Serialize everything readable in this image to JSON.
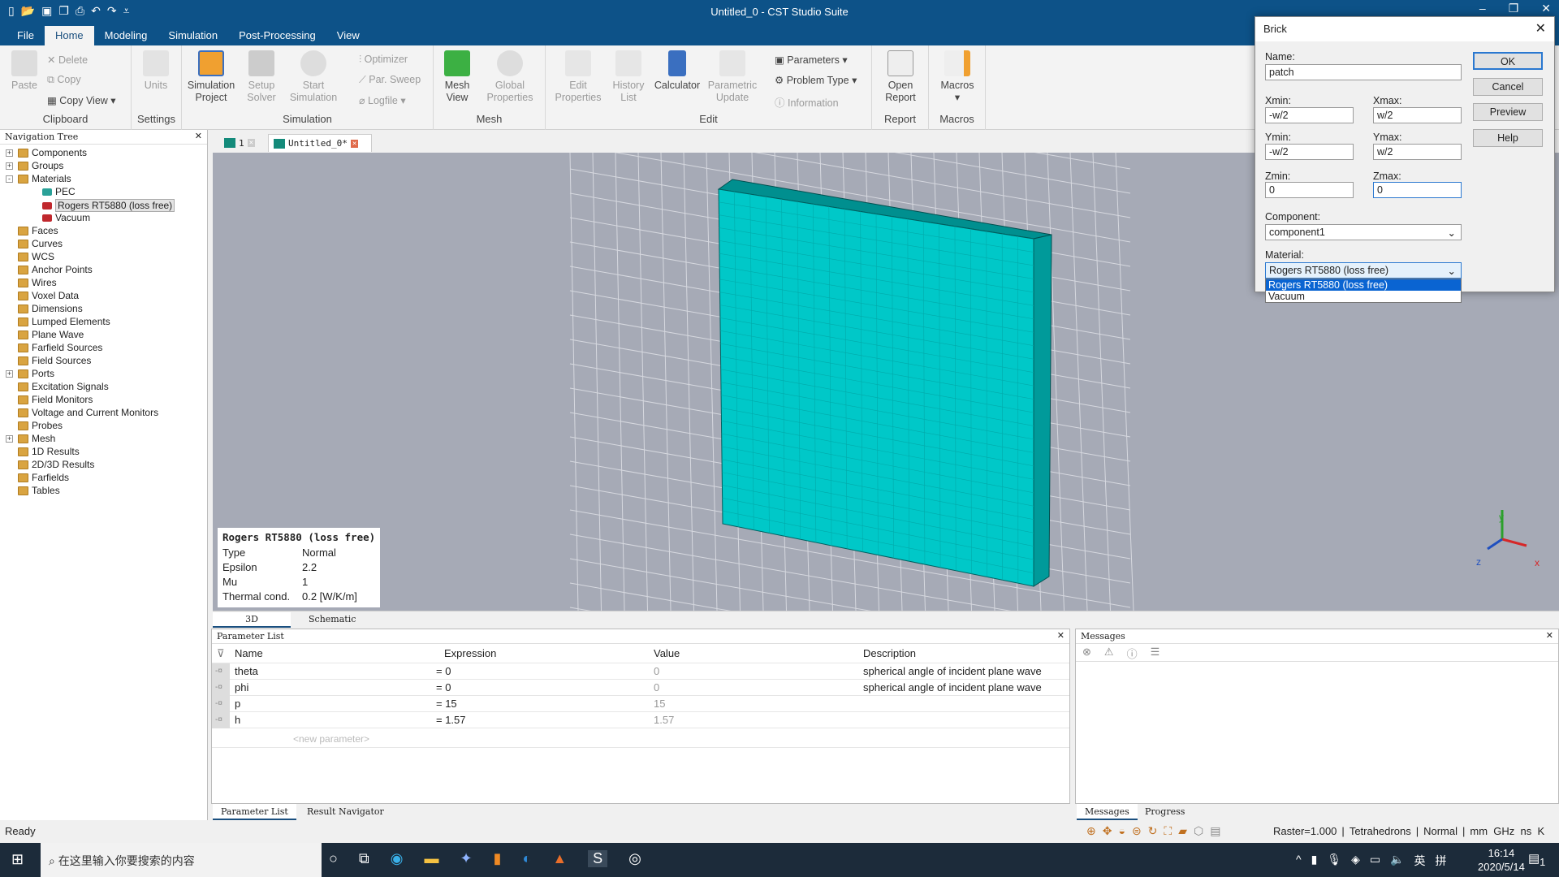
{
  "window": {
    "title": "Untitled_0 - CST Studio Suite",
    "qat_icons": [
      "new-icon",
      "open-icon",
      "save-icon",
      "save-all-icon",
      "print-icon",
      "undo-icon",
      "redo-icon",
      "customize-icon"
    ]
  },
  "menu": {
    "tabs": [
      "File",
      "Home",
      "Modeling",
      "Simulation",
      "Post-Processing",
      "View"
    ],
    "active": "Home"
  },
  "ribbon": {
    "clipboard": {
      "label": "Clipboard",
      "paste": "Paste",
      "delete": "Delete",
      "copy": "Copy",
      "copy_view": "Copy View"
    },
    "settings": {
      "label": "Settings",
      "units": "Units"
    },
    "simulation": {
      "label": "Simulation",
      "simulation_project": "Simulation Project",
      "setup_solver": "Setup Solver",
      "start_simulation": "Start Simulation",
      "optimizer": "Optimizer",
      "par_sweep": "Par. Sweep",
      "logfile": "Logfile"
    },
    "mesh": {
      "label": "Mesh",
      "mesh_view": "Mesh View",
      "global_properties": "Global Properties"
    },
    "edit": {
      "label": "Edit",
      "edit_properties": "Edit Properties",
      "history_list": "History List",
      "calculator": "Calculator",
      "parametric_update": "Parametric Update",
      "parameters": "Parameters",
      "problem_type": "Problem Type",
      "information": "Information"
    },
    "report": {
      "label": "Report",
      "open_report": "Open Report"
    },
    "macros": {
      "label": "Macros",
      "macros": "Macros"
    }
  },
  "nav": {
    "title": "Navigation Tree",
    "items": [
      {
        "label": "Components",
        "level": 0,
        "expander": "+"
      },
      {
        "label": "Groups",
        "level": 0,
        "expander": "+"
      },
      {
        "label": "Materials",
        "level": 0,
        "expander": "-"
      },
      {
        "label": "PEC",
        "level": 1,
        "color": "#2aa198"
      },
      {
        "label": "Rogers RT5880 (loss free)",
        "level": 1,
        "color": "#c0282d",
        "selected": true
      },
      {
        "label": "Vacuum",
        "level": 1,
        "color": "#c0282d"
      },
      {
        "label": "Faces",
        "level": 0
      },
      {
        "label": "Curves",
        "level": 0
      },
      {
        "label": "WCS",
        "level": 0
      },
      {
        "label": "Anchor Points",
        "level": 0
      },
      {
        "label": "Wires",
        "level": 0
      },
      {
        "label": "Voxel Data",
        "level": 0
      },
      {
        "label": "Dimensions",
        "level": 0
      },
      {
        "label": "Lumped Elements",
        "level": 0
      },
      {
        "label": "Plane Wave",
        "level": 0
      },
      {
        "label": "Farfield Sources",
        "level": 0
      },
      {
        "label": "Field Sources",
        "level": 0
      },
      {
        "label": "Ports",
        "level": 0,
        "expander": "+"
      },
      {
        "label": "Excitation Signals",
        "level": 0
      },
      {
        "label": "Field Monitors",
        "level": 0
      },
      {
        "label": "Voltage and Current Monitors",
        "level": 0
      },
      {
        "label": "Probes",
        "level": 0
      },
      {
        "label": "Mesh",
        "level": 0,
        "expander": "+"
      },
      {
        "label": "1D Results",
        "level": 0
      },
      {
        "label": "2D/3D Results",
        "level": 0
      },
      {
        "label": "Farfields",
        "level": 0
      },
      {
        "label": "Tables",
        "level": 0
      }
    ]
  },
  "doc_tabs": [
    "1",
    "Untitled_0*"
  ],
  "material_info": {
    "name": "Rogers RT5880 (loss free)",
    "rows": [
      [
        "Type",
        "Normal"
      ],
      [
        "Epsilon",
        "2.2"
      ],
      [
        "Mu",
        "1"
      ],
      [
        "Thermal cond.",
        "0.2 [W/K/m]"
      ]
    ]
  },
  "view": {
    "brick_color": "#00c8c8",
    "axes": [
      "y",
      "z",
      "x"
    ]
  },
  "view_tabs": [
    "3D",
    "Schematic"
  ],
  "param_list": {
    "title": "Parameter List",
    "headers": [
      "Name",
      "Expression",
      "Value",
      "Description"
    ],
    "rows": [
      [
        "theta",
        "= 0",
        "0",
        "spherical angle of incident plane wave"
      ],
      [
        "phi",
        "= 0",
        "0",
        "spherical angle of incident plane wave"
      ],
      [
        "p",
        "= 15",
        "15",
        ""
      ],
      [
        "h",
        "= 1.57",
        "1.57",
        ""
      ]
    ],
    "new_placeholder": "<new parameter>"
  },
  "messages": {
    "title": "Messages"
  },
  "bottom_tabs_left": [
    "Parameter List",
    "Result Navigator"
  ],
  "bottom_tabs_right": [
    "Messages",
    "Progress"
  ],
  "status": {
    "ready": "Ready",
    "raster": "Raster=1.000",
    "mesh": "Tetrahedrons",
    "mode": "Normal",
    "units": "mm  GHz  ns  K"
  },
  "taskbar": {
    "search_placeholder": "在这里输入你要搜索的内容",
    "time": "16:14",
    "date": "2020/5/14",
    "ime1": "英",
    "ime2": "拼",
    "notifications": "1"
  },
  "dialog": {
    "title": "Brick",
    "name_label": "Name:",
    "name": "patch",
    "xmin_label": "Xmin:",
    "xmin": "-w/2",
    "xmax_label": "Xmax:",
    "xmax": "w/2",
    "ymin_label": "Ymin:",
    "ymin": "-w/2",
    "ymax_label": "Ymax:",
    "ymax": "w/2",
    "zmin_label": "Zmin:",
    "zmin": "0",
    "zmax_label": "Zmax:",
    "zmax": "0",
    "component_label": "Component:",
    "component": "component1",
    "material_label": "Material:",
    "material": "Rogers RT5880 (loss free)",
    "material_options": [
      "Rogers RT5880 (loss free)",
      "Vacuum"
    ],
    "ok": "OK",
    "cancel": "Cancel",
    "preview": "Preview",
    "help": "Help"
  }
}
